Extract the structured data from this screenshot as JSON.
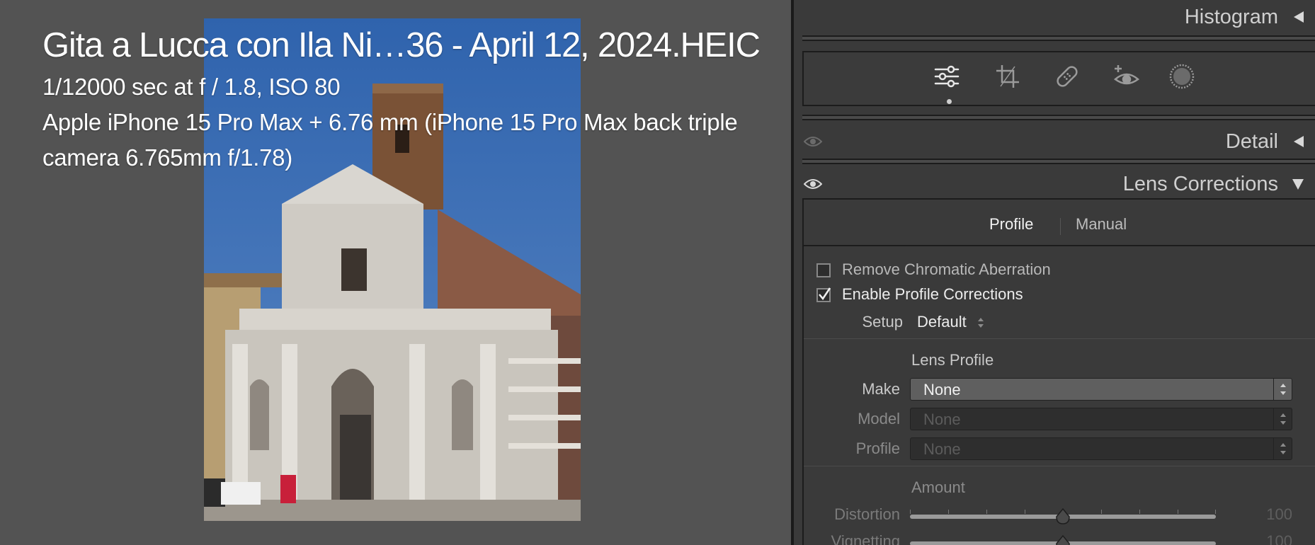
{
  "preview": {
    "title": "Gita a Lucca con Ila Ni…36 - April 12, 2024.HEIC",
    "exposure": "1/12000 sec at f / 1.8, ISO 80",
    "camera": "Apple iPhone 15 Pro Max + 6.76 mm (iPhone 15 Pro Max back triple camera 6.765mm f/1.78)"
  },
  "panel": {
    "histogram_label": "Histogram",
    "tools": [
      {
        "icon": "edit-sliders-icon",
        "active": true
      },
      {
        "icon": "crop-icon",
        "active": false
      },
      {
        "icon": "healing-bandage-icon",
        "active": false
      },
      {
        "icon": "red-eye-icon",
        "active": false
      },
      {
        "icon": "masking-icon",
        "active": false
      }
    ],
    "detail_label": "Detail",
    "lens_label": "Lens Corrections",
    "lens": {
      "tabs": [
        {
          "label": "Profile",
          "active": true
        },
        {
          "label": "Manual",
          "active": false
        }
      ],
      "remove_ca_label": "Remove Chromatic Aberration",
      "remove_ca_checked": false,
      "enable_profile_label": "Enable Profile Corrections",
      "enable_profile_checked": true,
      "setup_label": "Setup",
      "setup_value": "Default",
      "lens_profile_heading": "Lens Profile",
      "make_label": "Make",
      "make_value": "None",
      "model_label": "Model",
      "model_value": "None",
      "profile_label": "Profile",
      "profile_value": "None",
      "amount_heading": "Amount",
      "distortion_label": "Distortion",
      "distortion_value": "100",
      "vignetting_label": "Vignetting",
      "vignetting_value": "100"
    }
  },
  "colors": {
    "panel_bg": "#3a3a3a",
    "preview_bg": "#535353",
    "text": "#e6e6e6",
    "sky": "#3d6fb3"
  }
}
